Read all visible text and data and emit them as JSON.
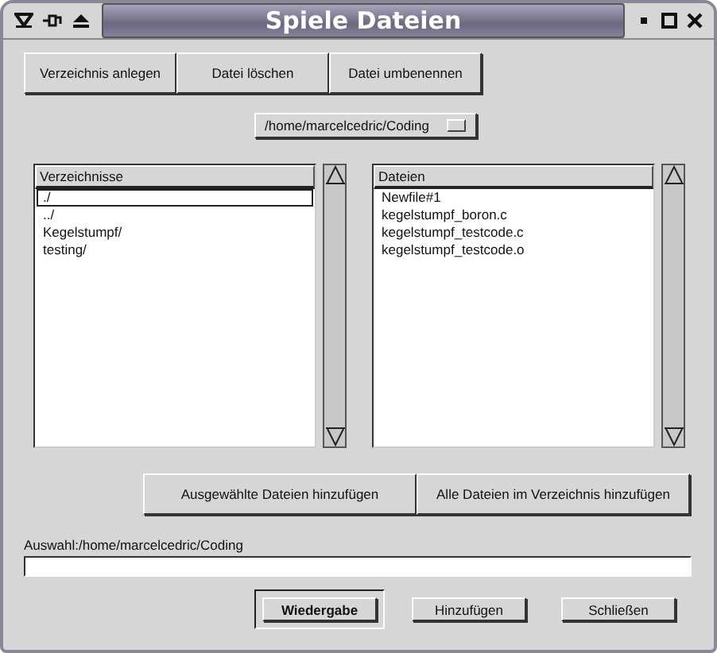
{
  "window": {
    "title": "Spiele Dateien"
  },
  "toolbar": [
    "Verzeichnis anlegen",
    "Datei löschen",
    "Datei umbenennen"
  ],
  "path_dropdown": {
    "value": "/home/marcelcedric/Coding"
  },
  "directories": {
    "header": "Verzeichnisse",
    "items": [
      {
        "label": "./",
        "selected": true
      },
      {
        "label": "../",
        "selected": false
      },
      {
        "label": "Kegelstumpf/",
        "selected": false
      },
      {
        "label": "testing/",
        "selected": false
      }
    ]
  },
  "files": {
    "header": "Dateien",
    "items": [
      {
        "label": "Newfile#1",
        "selected": false
      },
      {
        "label": "kegelstumpf_boron.c",
        "selected": false
      },
      {
        "label": "kegelstumpf_testcode.c",
        "selected": false
      },
      {
        "label": "kegelstumpf_testcode.o",
        "selected": false
      }
    ]
  },
  "add_buttons": [
    "Ausgewählte Dateien hinzufügen",
    "Alle Dateien im Verzeichnis hinzufügen"
  ],
  "selection": {
    "label": "Auswahl:/home/marcelcedric/Coding"
  },
  "buttons": [
    {
      "label": "Wiedergabe",
      "default": true
    },
    {
      "label": "Hinzufügen",
      "default": false
    },
    {
      "label": "Schließen",
      "default": false
    }
  ]
}
